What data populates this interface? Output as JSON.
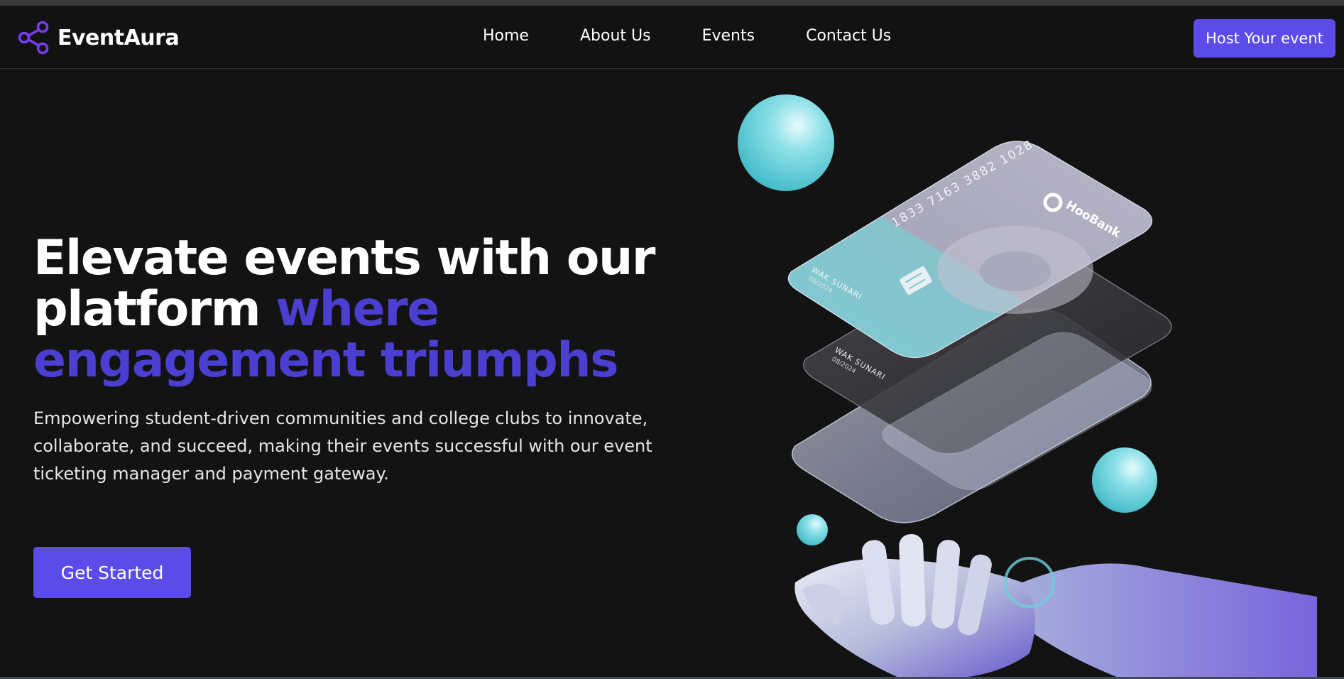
{
  "brand": {
    "name": "EventAura",
    "logo_icon": "share-nodes-icon",
    "accent": "#5b4ce8"
  },
  "nav": {
    "items": [
      {
        "label": "Home"
      },
      {
        "label": "About Us"
      },
      {
        "label": "Events"
      },
      {
        "label": "Contact Us"
      }
    ],
    "cta_label": "Host Your event"
  },
  "hero": {
    "title_line1": "Elevate events with our",
    "title_line2_plain": "platform",
    "title_line2_accent": "where",
    "title_line3_accent": "engagement triumphs",
    "subtitle": "Empowering student-driven communities and college clubs to innovate, collaborate, and succeed, making their events successful with our event ticketing manager and payment gateway.",
    "cta_label": "Get Started"
  },
  "illustration": {
    "card_number": "1833 7163 3882 1028",
    "bank_name": "HooBank",
    "cardholder": "WAK SUNARI",
    "expiry": "08/2024",
    "colors": {
      "sphere": "#6fd3dd",
      "card_teal": "#7cc9d2",
      "card_glass": "#9a9ab0",
      "hand": "#c9cfe6",
      "hand_accent": "#6f5cd6"
    }
  }
}
